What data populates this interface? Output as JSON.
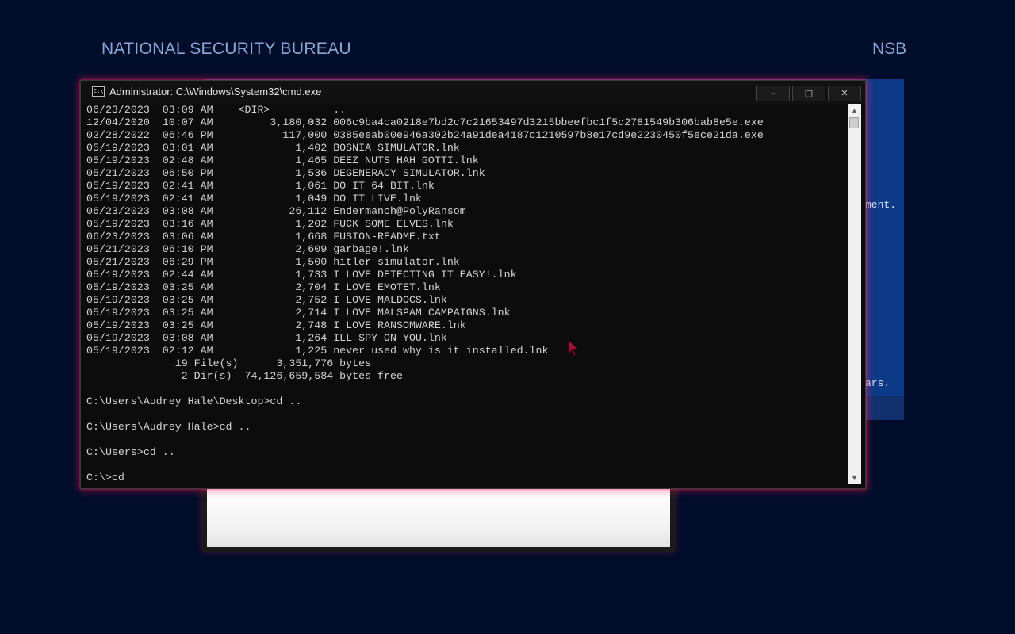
{
  "header": {
    "title": "NATIONAL SECURITY BUREAU",
    "abbr": "NSB"
  },
  "background_window": {
    "text_fragment_1": "ment.",
    "text_fragment_2": "ars."
  },
  "cmd_window": {
    "title": "Administrator: C:\\Windows\\System32\\cmd.exe",
    "icon": "cmd-icon",
    "icon_glyph": "C:\\",
    "buttons": {
      "minimize": "–",
      "maximize": "□",
      "close": "✕"
    },
    "lines": [
      "06/23/2023  03:09 AM    <DIR>          ..",
      "12/04/2020  10:07 AM         3,180,032 006c9ba4ca0218e7bd2c7c21653497d3215bbeefbc1f5c2781549b306bab8e5e.exe",
      "02/28/2022  06:46 PM           117,000 0385eeab00e946a302b24a91dea4187c1210597b8e17cd9e2230450f5ece21da.exe",
      "05/19/2023  03:01 AM             1,402 BOSNIA SIMULATOR.lnk",
      "05/19/2023  02:48 AM             1,465 DEEZ NUTS HAH GOTTI.lnk",
      "05/21/2023  06:50 PM             1,536 DEGENERACY SIMULATOR.lnk",
      "05/19/2023  02:41 AM             1,061 DO IT 64 BIT.lnk",
      "05/19/2023  02:41 AM             1,049 DO IT LIVE.lnk",
      "06/23/2023  03:08 AM            26,112 Endermanch@PolyRansom",
      "05/19/2023  03:16 AM             1,202 FUCK SOME ELVES.lnk",
      "06/23/2023  03:06 AM             1,668 FUSION-README.txt",
      "05/21/2023  06:10 PM             2,609 garbage!.lnk",
      "05/21/2023  06:29 PM             1,500 hitler simulator.lnk",
      "05/19/2023  02:44 AM             1,733 I LOVE DETECTING IT EASY!.lnk",
      "05/19/2023  03:25 AM             2,704 I LOVE EMOTET.lnk",
      "05/19/2023  03:25 AM             2,752 I LOVE MALDOCS.lnk",
      "05/19/2023  03:25 AM             2,714 I LOVE MALSPAM CAMPAIGNS.lnk",
      "05/19/2023  03:25 AM             2,748 I LOVE RANSOMWARE.lnk",
      "05/19/2023  03:08 AM             1,264 ILL SPY ON YOU.lnk",
      "05/19/2023  02:12 AM             1,225 never used why is it installed.lnk",
      "              19 File(s)      3,351,776 bytes",
      "               2 Dir(s)  74,126,659,584 bytes free",
      "",
      "C:\\Users\\Audrey Hale\\Desktop>cd ..",
      "",
      "C:\\Users\\Audrey Hale>cd ..",
      "",
      "C:\\Users>cd ..",
      "",
      "C:\\>cd"
    ],
    "scrollbar": {
      "up_arrow": "▲",
      "down_arrow": "▼"
    }
  },
  "pointer_color": "#a01030"
}
